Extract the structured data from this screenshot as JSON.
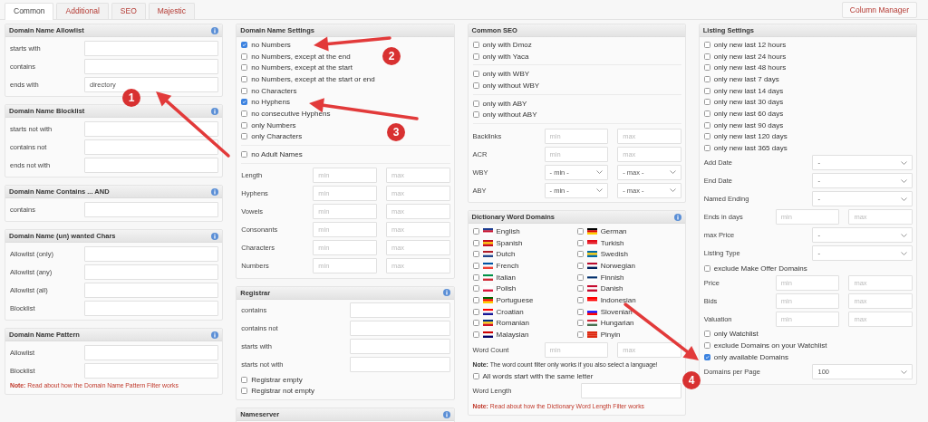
{
  "tabs": [
    {
      "label": "Common",
      "selected": true
    },
    {
      "label": "Additional",
      "selected": false
    },
    {
      "label": "SEO",
      "selected": false
    },
    {
      "label": "Majestic",
      "selected": false
    }
  ],
  "column_manager": "Column Manager",
  "columns": [
    {
      "panels": [
        {
          "title": "Domain Name Allowlist",
          "info": true,
          "rows": [
            {
              "kind": "text",
              "label": "starts with"
            },
            {
              "kind": "text",
              "label": "contains"
            },
            {
              "kind": "text",
              "label": "ends with",
              "value": "directory"
            }
          ]
        },
        {
          "title": "Domain Name Blocklist",
          "info": true,
          "rows": [
            {
              "kind": "text",
              "label": "starts not with"
            },
            {
              "kind": "text",
              "label": "contains not"
            },
            {
              "kind": "text",
              "label": "ends not with"
            }
          ]
        },
        {
          "title": "Domain Name Contains ... AND",
          "info": true,
          "rows": [
            {
              "kind": "text",
              "label": "contains"
            }
          ]
        },
        {
          "title": "Domain Name (un) wanted Chars",
          "info": true,
          "rows": [
            {
              "kind": "text",
              "label": "Allowlist (only)"
            },
            {
              "kind": "text",
              "label": "Allowlist (any)"
            },
            {
              "kind": "text",
              "label": "Allowlist (all)"
            },
            {
              "kind": "text",
              "label": "Blocklist"
            }
          ]
        },
        {
          "title": "Domain Name Pattern",
          "info": true,
          "rows": [
            {
              "kind": "text",
              "label": "Allowlist"
            },
            {
              "kind": "text",
              "label": "Blocklist"
            },
            {
              "kind": "note",
              "text": "**Note:** Read about how the Domain Name Pattern Filter works",
              "link": true
            }
          ]
        }
      ]
    },
    {
      "panels": [
        {
          "title": "Domain Name Settings",
          "info": false,
          "rows": [
            {
              "kind": "checkbox",
              "label": "no Numbers",
              "checked": true
            },
            {
              "kind": "checkbox",
              "label": "no Numbers, except at the end",
              "checked": false
            },
            {
              "kind": "checkbox",
              "label": "no Numbers, except at the start",
              "checked": false
            },
            {
              "kind": "checkbox",
              "label": "no Numbers, except at the start or end",
              "checked": false
            },
            {
              "kind": "checkbox",
              "label": "no Characters",
              "checked": false
            },
            {
              "kind": "checkbox",
              "label": "no Hyphens",
              "checked": true
            },
            {
              "kind": "checkbox",
              "label": "no consecutive Hyphens",
              "checked": false
            },
            {
              "kind": "checkbox",
              "label": "only Numbers",
              "checked": false
            },
            {
              "kind": "checkbox",
              "label": "only Characters",
              "checked": false
            },
            {
              "kind": "divider"
            },
            {
              "kind": "checkbox",
              "label": "no Adult Names",
              "checked": false
            },
            {
              "kind": "divider"
            },
            {
              "kind": "range",
              "label": "Length",
              "placeholders": [
                "min",
                "max"
              ]
            },
            {
              "kind": "range",
              "label": "Hyphens",
              "placeholders": [
                "min",
                "max"
              ]
            },
            {
              "kind": "range",
              "label": "Vowels",
              "placeholders": [
                "min",
                "max"
              ]
            },
            {
              "kind": "range",
              "label": "Consonants",
              "placeholders": [
                "min",
                "max"
              ]
            },
            {
              "kind": "range",
              "label": "Characters",
              "placeholders": [
                "min",
                "max"
              ]
            },
            {
              "kind": "range",
              "label": "Numbers",
              "placeholders": [
                "min",
                "max"
              ]
            }
          ]
        },
        {
          "title": "Registrar",
          "info": true,
          "rows": [
            {
              "kind": "text",
              "label": "contains"
            },
            {
              "kind": "text",
              "label": "contains not"
            },
            {
              "kind": "text",
              "label": "starts with"
            },
            {
              "kind": "text",
              "label": "starts not with"
            },
            {
              "kind": "checkbox",
              "label": "Registrar empty",
              "checked": false
            },
            {
              "kind": "checkbox",
              "label": "Registrar not empty",
              "checked": false
            }
          ]
        },
        {
          "title": "Nameserver",
          "info": true
        }
      ]
    },
    {
      "panels": [
        {
          "title": "Common SEO",
          "info": false,
          "rows": [
            {
              "kind": "checkbox",
              "label": "only with Dmoz",
              "checked": false
            },
            {
              "kind": "checkbox",
              "label": "only with Yaca",
              "checked": false
            },
            {
              "kind": "divider"
            },
            {
              "kind": "checkbox",
              "label": "only with WBY",
              "checked": false
            },
            {
              "kind": "checkbox",
              "label": "only without WBY",
              "checked": false
            },
            {
              "kind": "divider"
            },
            {
              "kind": "checkbox",
              "label": "only with ABY",
              "checked": false
            },
            {
              "kind": "checkbox",
              "label": "only without ABY",
              "checked": false
            },
            {
              "kind": "divider"
            },
            {
              "kind": "range",
              "label": "Backlinks",
              "placeholders": [
                "min",
                "max"
              ]
            },
            {
              "kind": "range",
              "label": "ACR",
              "placeholders": [
                "min",
                "max"
              ]
            },
            {
              "kind": "range_select",
              "label": "WBY",
              "values": [
                "- min -",
                "- max -"
              ]
            },
            {
              "kind": "range_select",
              "label": "ABY",
              "values": [
                "- min -",
                "- max -"
              ]
            }
          ]
        },
        {
          "title": "Dictionary Word Domains",
          "info": true,
          "rows": [
            {
              "kind": "languages",
              "items": [
                {
                  "label": "English",
                  "checked": false
                },
                {
                  "label": "German",
                  "checked": false
                },
                {
                  "label": "Spanish",
                  "checked": false
                },
                {
                  "label": "Turkish",
                  "checked": false
                },
                {
                  "label": "Dutch",
                  "checked": false
                },
                {
                  "label": "Swedish",
                  "checked": false
                },
                {
                  "label": "French",
                  "checked": false
                },
                {
                  "label": "Norwegian",
                  "checked": false
                },
                {
                  "label": "Italian",
                  "checked": false
                },
                {
                  "label": "Finnish",
                  "checked": false
                },
                {
                  "label": "Polish",
                  "checked": false
                },
                {
                  "label": "Danish",
                  "checked": false
                },
                {
                  "label": "Portuguese",
                  "checked": false
                },
                {
                  "label": "Indonesian",
                  "checked": false
                },
                {
                  "label": "Croatian",
                  "checked": false
                },
                {
                  "label": "Slovenian",
                  "checked": false
                },
                {
                  "label": "Romanian",
                  "checked": false
                },
                {
                  "label": "Hungarian",
                  "checked": false
                },
                {
                  "label": "Malaysian",
                  "checked": false
                },
                {
                  "label": "Pinyin",
                  "checked": false
                }
              ]
            },
            {
              "kind": "range",
              "label": "Word Count",
              "placeholders": [
                "min",
                "max"
              ]
            },
            {
              "kind": "note",
              "text": "**Note:** The word count filter only works if you also select a language!",
              "link": false
            },
            {
              "kind": "checkbox",
              "label": "All words start with the same letter",
              "checked": false
            },
            {
              "kind": "text",
              "label": "Word Length"
            },
            {
              "kind": "note",
              "text": "**Note:** Read about how the Dictionary Word Length Filter works",
              "link": true
            }
          ]
        }
      ]
    },
    {
      "panels": [
        {
          "title": "Listing Settings",
          "info": false,
          "rows": [
            {
              "kind": "checkbox",
              "label": "only new last 12 hours",
              "checked": false
            },
            {
              "kind": "checkbox",
              "label": "only new last 24 hours",
              "checked": false
            },
            {
              "kind": "checkbox",
              "label": "only new last 48 hours",
              "checked": false
            },
            {
              "kind": "checkbox",
              "label": "only new last 7 days",
              "checked": false
            },
            {
              "kind": "checkbox",
              "label": "only new last 14 days",
              "checked": false
            },
            {
              "kind": "checkbox",
              "label": "only new last 30 days",
              "checked": false
            },
            {
              "kind": "checkbox",
              "label": "only new last 60 days",
              "checked": false
            },
            {
              "kind": "checkbox",
              "label": "only new last 90 days",
              "checked": false
            },
            {
              "kind": "checkbox",
              "label": "only new last 120 days",
              "checked": false
            },
            {
              "kind": "checkbox",
              "label": "only new last 365 days",
              "checked": false
            },
            {
              "kind": "select",
              "label": "Add Date",
              "value": "-"
            },
            {
              "kind": "select",
              "label": "End Date",
              "value": "-"
            },
            {
              "kind": "select",
              "label": "Named Ending",
              "value": "-"
            },
            {
              "kind": "range",
              "label": "Ends in days",
              "placeholders": [
                "min",
                "max"
              ]
            },
            {
              "kind": "select",
              "label": "max Price",
              "value": "-"
            },
            {
              "kind": "select",
              "label": "Listing Type",
              "value": "-"
            },
            {
              "kind": "checkbox",
              "label": "exclude Make Offer Domains",
              "checked": false
            },
            {
              "kind": "range",
              "label": "Price",
              "placeholders": [
                "min",
                "max"
              ]
            },
            {
              "kind": "range",
              "label": "Bids",
              "placeholders": [
                "min",
                "max"
              ]
            },
            {
              "kind": "range",
              "label": "Valuation",
              "placeholders": [
                "min",
                "max"
              ]
            },
            {
              "kind": "checkbox",
              "label": "only Watchlist",
              "checked": false
            },
            {
              "kind": "checkbox",
              "label": "exclude Domains on your Watchlist",
              "checked": false
            },
            {
              "kind": "checkbox",
              "label": "only available Domains",
              "checked": true
            },
            {
              "kind": "select",
              "label": "Domains per Page",
              "value": "100"
            }
          ]
        }
      ]
    }
  ],
  "annotations": [
    {
      "label": "1"
    },
    {
      "label": "2"
    },
    {
      "label": "3"
    },
    {
      "label": "4"
    }
  ]
}
